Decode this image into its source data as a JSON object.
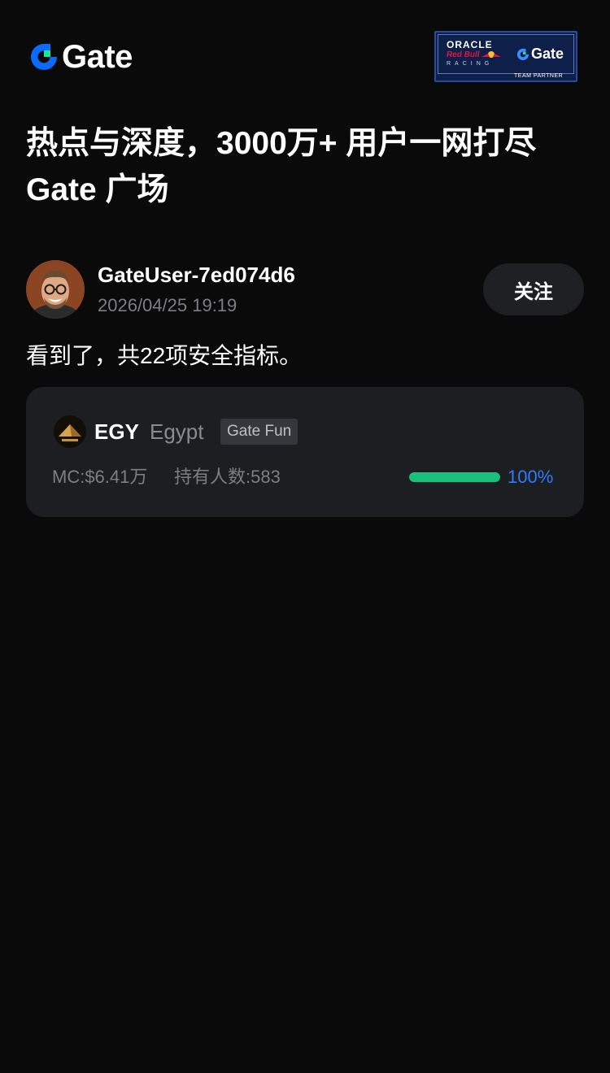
{
  "header": {
    "logo_text": "Gate",
    "partner": {
      "oracle": "ORACLE",
      "redbull": "Red Bull",
      "racing": "RACING",
      "gate": "Gate",
      "tag": "TEAM PARTNER"
    }
  },
  "headline": {
    "line1": "热点与深度，3000万+ 用户一网打尽",
    "line2": "Gate 广场"
  },
  "post": {
    "username": "GateUser-7ed074d6",
    "timestamp": "2026/04/25 19:19",
    "follow_label": "关注",
    "text": "看到了，共22项安全指标。"
  },
  "token": {
    "symbol": "EGY",
    "name": "Egypt",
    "badge": "Gate Fun",
    "market_cap": "MC:$6.41万",
    "holders": "持有人数:583",
    "progress_label": "100%",
    "progress_fraction": 1.0
  },
  "colors": {
    "background": "#0a0a0b",
    "card": "#1d1e22",
    "accent_blue": "#2e7bff",
    "progress_green": "#18c27a",
    "muted_text": "#7d7d82"
  },
  "icons": {
    "logo": "gate-logo-icon",
    "avatar": "user-avatar",
    "token": "pyramid-token-icon"
  }
}
